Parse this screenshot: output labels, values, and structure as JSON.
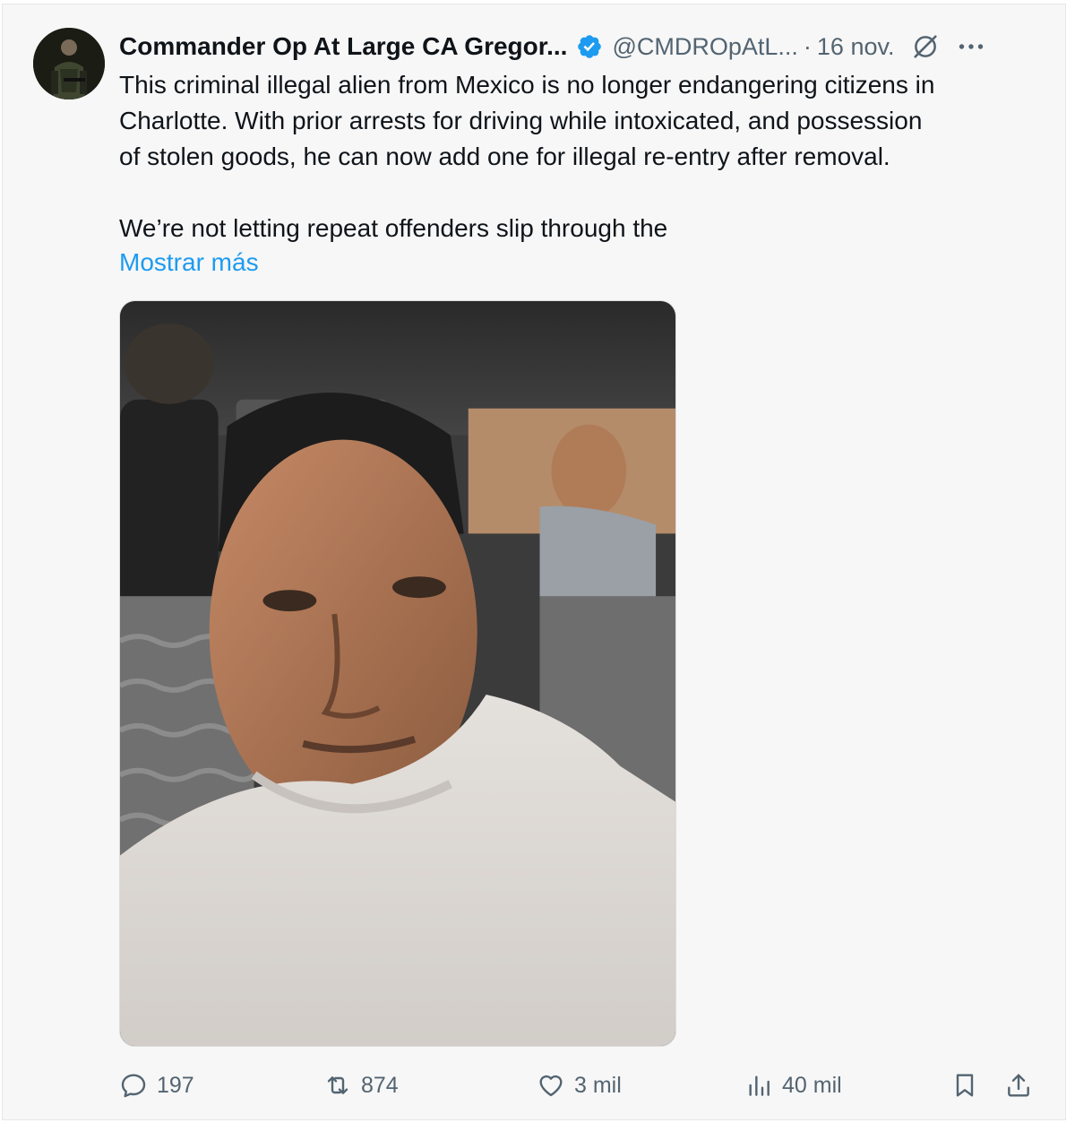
{
  "author": {
    "display_name": "Commander Op At Large CA Gregor...",
    "handle": "@CMDROpAtL...",
    "separator": "·",
    "date": "16 nov.",
    "verified": true,
    "avatar_icon": "avatar-portrait"
  },
  "tweet": {
    "lines": [
      "This criminal illegal alien from Mexico is no longer endangering  citizens in",
      "Charlotte.  With prior arrests for driving while intoxicated, and possession",
      "of stolen goods, he can now add one for illegal re-entry after removal."
    ],
    "line_after_gap": "We’re not letting repeat offenders slip through the",
    "show_more": "Mostrar más"
  },
  "icons": {
    "verified": "verified-badge-icon",
    "grok": "grok-icon",
    "more": "more-options-icon"
  },
  "actions": {
    "replies": "197",
    "reposts": "874",
    "likes": "3 mil",
    "views": "40 mil"
  },
  "colors": {
    "accent": "#1d9bf0",
    "muted": "#536471",
    "text": "#0f1419",
    "background": "#f7f7f7"
  }
}
